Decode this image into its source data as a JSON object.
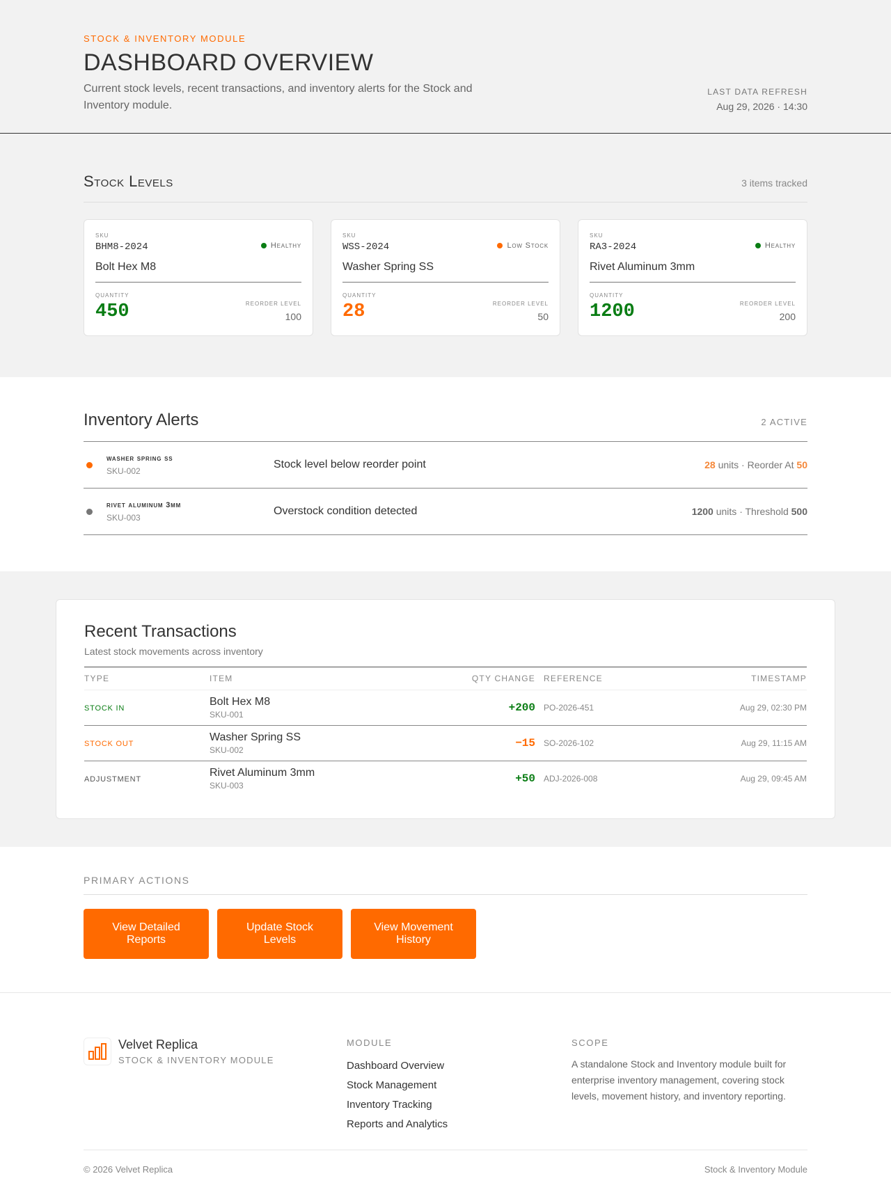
{
  "header": {
    "eyebrow": "STOCK & INVENTORY MODULE",
    "title": "DASHBOARD OVERVIEW",
    "description": "Current stock levels, recent transactions, and inventory alerts for the Stock and Inventory module.",
    "refresh_label": "LAST DATA REFRESH",
    "refresh_value": "Aug 29, 2026 · 14:30"
  },
  "stock_levels": {
    "title": "Stock Levels",
    "count_text": "3 items tracked",
    "sku_label": "SKU",
    "quantity_label": "QUANTITY",
    "reorder_label": "REORDER LEVEL",
    "cards": [
      {
        "sku": "BHM8-2024",
        "name": "Bolt Hex M8",
        "status": "Healthy",
        "status_color": "#0a7d14",
        "quantity": "450",
        "quantity_color": "#0a7d14",
        "reorder": "100"
      },
      {
        "sku": "WSS-2024",
        "name": "Washer Spring SS",
        "status": "Low Stock",
        "status_color": "#ff6a00",
        "quantity": "28",
        "quantity_color": "#ff6a00",
        "reorder": "50"
      },
      {
        "sku": "RA3-2024",
        "name": "Rivet Aluminum 3mm",
        "status": "Healthy",
        "status_color": "#0a7d14",
        "quantity": "1200",
        "quantity_color": "#0a7d14",
        "reorder": "200"
      }
    ]
  },
  "alerts": {
    "title": "Inventory Alerts",
    "count": "2 ACTIVE",
    "rows": [
      {
        "dot_color": "#ff6a00",
        "item": "Washer Spring SS",
        "sku": "SKU-002",
        "message": "Stock level below reorder point",
        "value": "28",
        "units_text": " units · Reorder At ",
        "limit": "50",
        "value_color": "#f5883a"
      },
      {
        "dot_color": "#777777",
        "item": "Rivet Aluminum 3mm",
        "sku": "SKU-003",
        "message": "Overstock condition detected",
        "value": "1200",
        "units_text": " units · Threshold ",
        "limit": "500",
        "value_color": "#666666"
      }
    ]
  },
  "transactions": {
    "title": "Recent Transactions",
    "subtitle": "Latest stock movements across inventory",
    "columns": [
      "TYPE",
      "ITEM",
      "QTY CHANGE",
      "REFERENCE",
      "TIMESTAMP"
    ],
    "rows": [
      {
        "type": "STOCK IN",
        "type_color": "#0a7d14",
        "item": "Bolt Hex M8",
        "sku": "SKU-001",
        "qty": "+200",
        "qty_color": "#0a7d14",
        "reference": "PO-2026-451",
        "timestamp": "Aug 29, 02:30 PM"
      },
      {
        "type": "STOCK OUT",
        "type_color": "#ff6a00",
        "item": "Washer Spring SS",
        "sku": "SKU-002",
        "qty": "−15",
        "qty_color": "#ff6a00",
        "reference": "SO-2026-102",
        "timestamp": "Aug 29, 11:15 AM"
      },
      {
        "type": "ADJUSTMENT",
        "type_color": "#555555",
        "item": "Rivet Aluminum 3mm",
        "sku": "SKU-003",
        "qty": "+50",
        "qty_color": "#0a7d14",
        "reference": "ADJ-2026-008",
        "timestamp": "Aug 29, 09:45 AM"
      }
    ]
  },
  "actions": {
    "label": "PRIMARY ACTIONS",
    "buttons": [
      "View Detailed Reports",
      "Update Stock Levels",
      "View Movement History"
    ]
  },
  "footer": {
    "brand_name": "Velvet Replica",
    "brand_sub": "STOCK & INVENTORY MODULE",
    "brand_icon": "bar-chart-icon",
    "module_heading": "MODULE",
    "module_links": [
      "Dashboard Overview",
      "Stock Management",
      "Inventory Tracking",
      "Reports and Analytics"
    ],
    "scope_heading": "SCOPE",
    "scope_text": "A standalone Stock and Inventory module built for enterprise inventory management, covering stock levels, movement history, and inventory reporting.",
    "copyright": "© 2026 Velvet Replica",
    "bottom_right": "Stock & Inventory Module"
  },
  "colors": {
    "accent": "#ff6a00",
    "healthy": "#0a7d14"
  }
}
